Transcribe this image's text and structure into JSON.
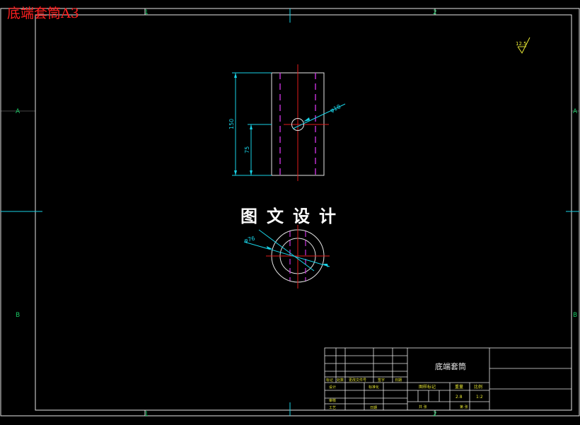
{
  "sheet": {
    "tag": "底端套筒A3",
    "watermark": "图文设计",
    "zones_top": [
      "1",
      "2"
    ],
    "zones_bottom": [
      "1",
      "2"
    ],
    "zones_side": [
      "A",
      "B"
    ]
  },
  "dimensions": {
    "height_total": "150",
    "height_half": "75",
    "hole_dia": "φ18",
    "outer_dia": "φ76",
    "roughness": "12.5"
  },
  "title_block": {
    "part_name": "底端套筒",
    "rev_headers": [
      "标记",
      "处数",
      "更改文件号",
      "签字",
      "日期"
    ],
    "design": "设计",
    "standard": "标准化",
    "review": "审核",
    "process": "工艺",
    "approve": "日期",
    "stage_mark": "图样标记",
    "weight": "重量",
    "scale": "比例",
    "weight_val": "2.8",
    "scale_val": "1:2",
    "sheets_total": "共 张",
    "sheet_no": "第 张"
  },
  "colors": {
    "frame": "#e6e6e6",
    "dim": "#19d2e6",
    "center": "#e01c1c",
    "hidden": "#c832dc",
    "text_green": "#00e05a",
    "zone_text": "#19c864"
  }
}
